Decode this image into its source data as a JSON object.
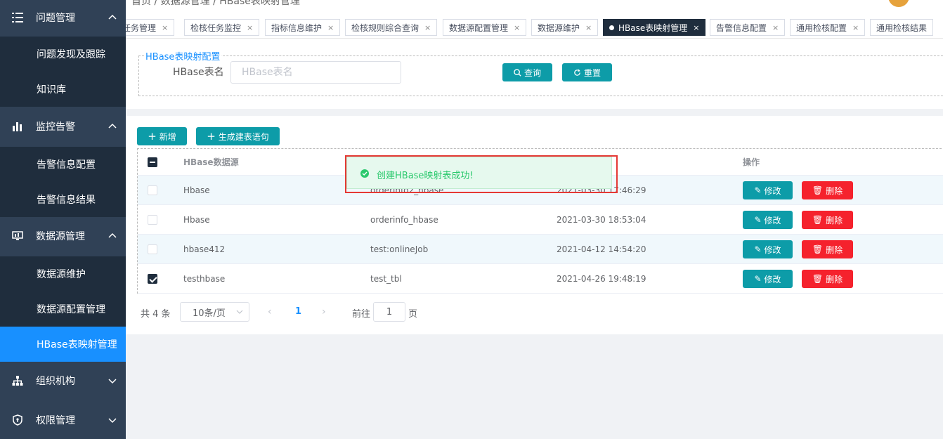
{
  "topbar": {
    "breadcrumb": "首页 / 数据源管理 / HBase表映射管理"
  },
  "sidebar": {
    "groups": [
      {
        "label": "问题管理",
        "icon": "list-icon",
        "items": [
          "问题发现及跟踪",
          "知识库"
        ]
      },
      {
        "label": "监控告警",
        "icon": "bar-chart-icon",
        "items": [
          "告警信息配置",
          "告警信息结果"
        ]
      },
      {
        "label": "数据源管理",
        "icon": "monitor-icon",
        "items": [
          "数据源维护",
          "数据源配置管理",
          "HBase表映射管理"
        ]
      },
      {
        "label": "组织机构",
        "icon": "org-icon",
        "items": []
      },
      {
        "label": "权限管理",
        "icon": "shield-icon",
        "items": []
      }
    ],
    "active_item": "HBase表映射管理"
  },
  "tags": [
    {
      "label": "任务管理",
      "active": false
    },
    {
      "label": "检核任务监控",
      "active": false
    },
    {
      "label": "指标信息维护",
      "active": false
    },
    {
      "label": "检核规则综合查询",
      "active": false
    },
    {
      "label": "数据源配置管理",
      "active": false
    },
    {
      "label": "数据源维护",
      "active": false
    },
    {
      "label": "HBase表映射管理",
      "active": true
    },
    {
      "label": "告警信息配置",
      "active": false
    },
    {
      "label": "通用检核配置",
      "active": false
    },
    {
      "label": "通用检核结果",
      "active": false
    }
  ],
  "tag_close": "×",
  "search": {
    "legend": "HBase表映射配置",
    "label": "HBase表名",
    "placeholder": "HBase表名",
    "value": "",
    "query_label": "查询",
    "reset_label": "重置"
  },
  "toolbar": {
    "add_label": "新增",
    "gen_sql_label": "生成建表语句"
  },
  "table": {
    "columns": [
      "HBase数据源",
      "",
      "",
      "操作"
    ],
    "rows": [
      {
        "source": "Hbase",
        "table": "orderinfo2_hbase",
        "time": "2021-03-30 17:46:29",
        "checked": false
      },
      {
        "source": "Hbase",
        "table": "orderinfo_hbase",
        "time": "2021-03-30 18:53:04",
        "checked": false
      },
      {
        "source": "hbase412",
        "table": "test:onlineJob",
        "time": "2021-04-12 14:54:20",
        "checked": false
      },
      {
        "source": "testhbase",
        "table": "test_tbl",
        "time": "2021-04-26 19:48:19",
        "checked": true
      }
    ],
    "edit_label": "修改",
    "delete_label": "删除"
  },
  "pagination": {
    "total_text": "共 4 条",
    "page_size": "10条/页",
    "current_page": "1",
    "goto_label": "前往",
    "goto_value": "1",
    "unit": "页"
  },
  "toast": {
    "message": "创建HBase映射表成功!"
  },
  "colors": {
    "sidebar": "#304156",
    "active": "#1890ff",
    "teal": "#0d9ca8",
    "danger": "#f5222d",
    "success": "#2bc96d"
  }
}
